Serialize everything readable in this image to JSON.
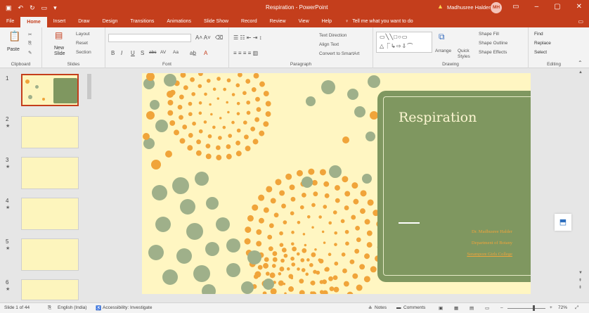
{
  "titlebar": {
    "doc_title": "Respiration - PowerPoint",
    "user_name": "Madhusree Halder",
    "user_initials": "MH"
  },
  "tabs": [
    "File",
    "Home",
    "Insert",
    "Draw",
    "Design",
    "Transitions",
    "Animations",
    "Slide Show",
    "Record",
    "Review",
    "View",
    "Help"
  ],
  "tell_me": "Tell me what you want to do",
  "ribbon": {
    "clipboard": {
      "label": "Clipboard",
      "paste": "Paste"
    },
    "slides": {
      "label": "Slides",
      "new_slide": "New",
      "new_slide2": "Slide",
      "layout": "Layout",
      "reset": "Reset",
      "section": "Section"
    },
    "font": {
      "label": "Font",
      "bold": "B",
      "italic": "I",
      "underline": "U",
      "strike": "S",
      "abc": "abc",
      "aa": "Aa"
    },
    "paragraph": {
      "label": "Paragraph",
      "text_direction": "Text Direction",
      "align_text": "Align Text",
      "smartart": "Convert to SmartArt"
    },
    "drawing": {
      "label": "Drawing",
      "arrange": "Arrange",
      "quick_styles": "Quick Styles",
      "shape_fill": "Shape Fill",
      "shape_outline": "Shape Outline",
      "shape_effects": "Shape Effects"
    },
    "editing": {
      "label": "Editing",
      "find": "Find",
      "replace": "Replace",
      "select": "Select"
    }
  },
  "thumbnails": [
    {
      "num": "1",
      "star": ""
    },
    {
      "num": "2",
      "star": "★"
    },
    {
      "num": "3",
      "star": "★"
    },
    {
      "num": "4",
      "star": "★"
    },
    {
      "num": "5",
      "star": "★"
    },
    {
      "num": "6",
      "star": "★"
    }
  ],
  "slide": {
    "title": "Respiration",
    "author": "Dr. Madhusree Halder",
    "dept": "Department of Botany",
    "college": "Serampore Girls College"
  },
  "statusbar": {
    "slide_count": "Slide 1 of 44",
    "language": "English (India)",
    "accessibility": "Accessibility: Investigate",
    "notes": "Notes",
    "comments": "Comments",
    "zoom": "72%"
  },
  "colors": {
    "accent": "#c43e1c",
    "slide_bg": "#fff6c2",
    "panel": "#7f9760",
    "orange": "#f0a43a",
    "sage": "#9fb08a"
  }
}
